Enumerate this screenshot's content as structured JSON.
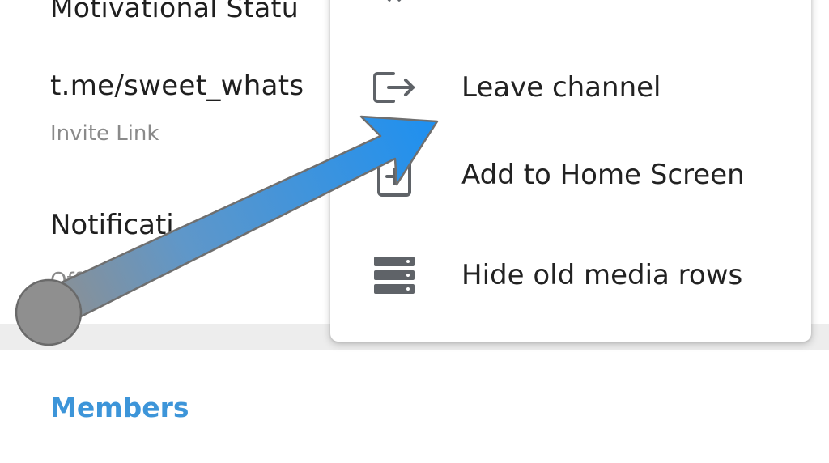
{
  "channel_info": {
    "title": "Motivational Statu",
    "link": "t.me/sweet_whats",
    "link_caption": "Invite Link",
    "notifications_label": "Notificati",
    "notifications_value": "Off"
  },
  "members": {
    "title": "Members"
  },
  "menu": {
    "items": [
      {
        "label": "Leave channel",
        "icon": "leave-icon"
      },
      {
        "label": "Add to Home Screen",
        "icon": "add-home-icon"
      },
      {
        "label": "Hide old media rows",
        "icon": "stack-icon"
      }
    ]
  },
  "colors": {
    "accent": "#3d95d9",
    "text": "#222222",
    "secondary_text": "#8a8a8a",
    "icon": "#5f6368",
    "divider": "#ededed",
    "arrow_start": "#8f8f8f",
    "arrow_end": "#1e90f0"
  }
}
